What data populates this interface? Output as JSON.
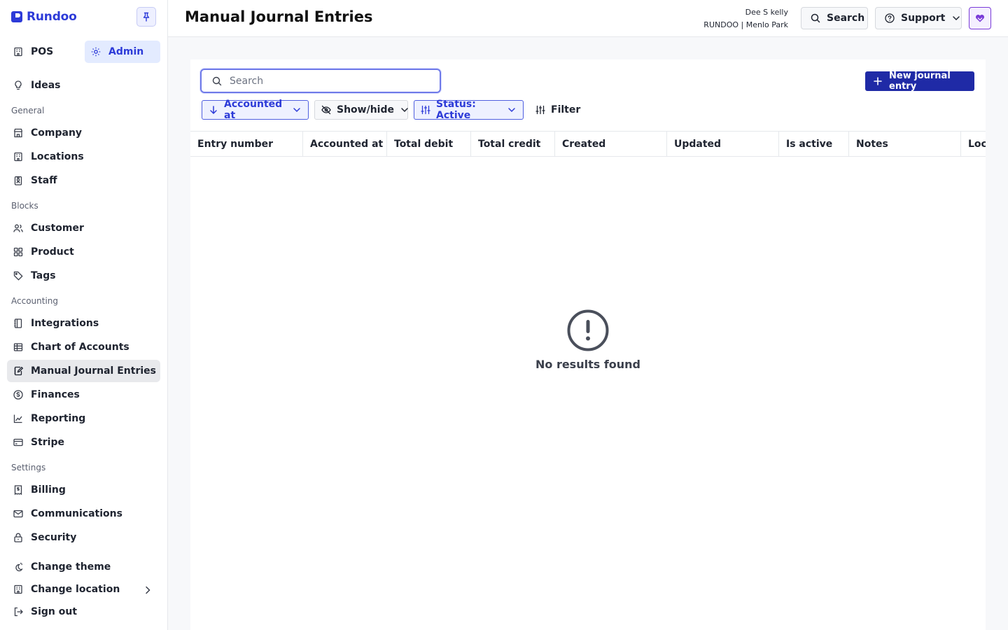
{
  "brand": {
    "name": "Rundoo",
    "color": "#2d3bd8"
  },
  "modes": [
    {
      "label": "POS",
      "icon": "building-icon"
    },
    {
      "label": "Admin",
      "icon": "gear-icon",
      "active": true
    }
  ],
  "sidebar": {
    "top_items": [
      {
        "label": "Ideas",
        "icon": "lightbulb-icon"
      }
    ],
    "sections": [
      {
        "title": "General",
        "items": [
          {
            "label": "Company",
            "icon": "store-icon"
          },
          {
            "label": "Locations",
            "icon": "building-icon"
          },
          {
            "label": "Staff",
            "icon": "badge-icon"
          }
        ]
      },
      {
        "title": "Blocks",
        "items": [
          {
            "label": "Customer",
            "icon": "users-icon"
          },
          {
            "label": "Product",
            "icon": "grid-icon"
          },
          {
            "label": "Tags",
            "icon": "tag-icon"
          }
        ]
      },
      {
        "title": "Accounting",
        "items": [
          {
            "label": "Integrations",
            "icon": "notebook-icon"
          },
          {
            "label": "Chart of Accounts",
            "icon": "table-icon"
          },
          {
            "label": "Manual Journal Entries",
            "icon": "journal-edit-icon",
            "active": true
          },
          {
            "label": "Finances",
            "icon": "dollar-circle-icon"
          },
          {
            "label": "Reporting",
            "icon": "line-chart-icon"
          },
          {
            "label": "Stripe",
            "icon": "credit-card-icon"
          }
        ]
      },
      {
        "title": "Settings",
        "items": [
          {
            "label": "Billing",
            "icon": "receipt-icon"
          },
          {
            "label": "Communications",
            "icon": "mail-icon"
          },
          {
            "label": "Security",
            "icon": "lock-icon"
          }
        ]
      }
    ],
    "footer_items": [
      {
        "label": "Change theme",
        "icon": "theme-icon"
      },
      {
        "label": "Change location",
        "icon": "building-icon"
      },
      {
        "label": "Sign out",
        "icon": "sign-out-icon"
      }
    ]
  },
  "header": {
    "title": "Manual Journal Entries",
    "user_name": "Dee S kelly",
    "org_location": "RUNDOO | Menlo Park",
    "search_label": "Search",
    "support_label": "Support"
  },
  "toolbar": {
    "search_placeholder": "Search",
    "search_value": "",
    "new_button_label": "New journal entry",
    "sort_label": "Accounted at",
    "showhide_label": "Show/hide",
    "status_label": "Status: Active",
    "filter_label": "Filter"
  },
  "table": {
    "columns": [
      "Entry number",
      "Accounted at",
      "Total debit",
      "Total credit",
      "Created",
      "Updated",
      "Is active",
      "Notes",
      "Location"
    ],
    "rows": []
  },
  "empty_state": {
    "message": "No results found",
    "icon": "exclamation-circle-icon"
  },
  "colors": {
    "accent": "#2d3bd8",
    "primary_button": "#1f2aa6",
    "avatar_accent": "#7a3bd8"
  }
}
